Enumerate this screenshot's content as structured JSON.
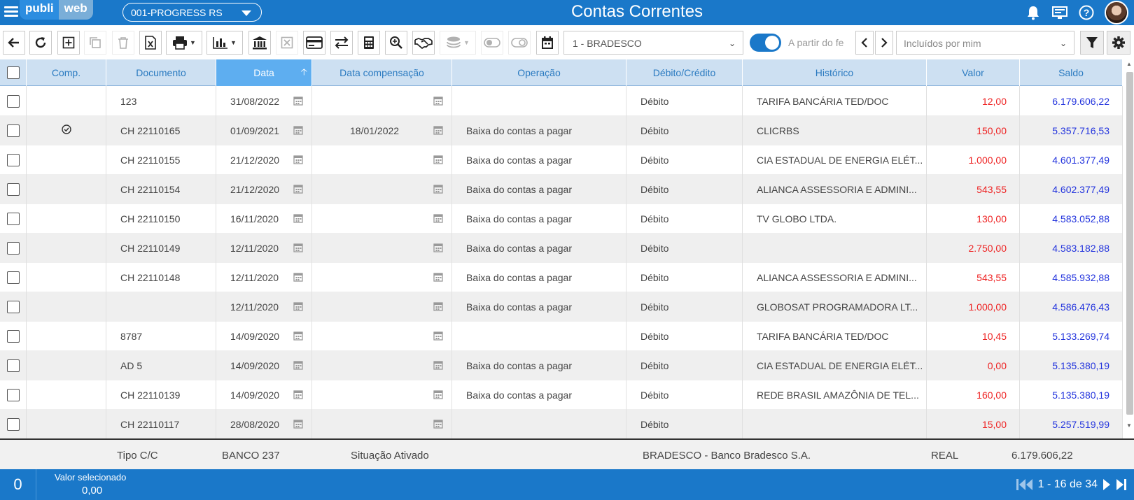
{
  "header": {
    "logo_left": "publi",
    "logo_right": "web",
    "company": "001-PROGRESS RS",
    "title": "Contas Correntes",
    "icons": [
      "bell-icon",
      "monitor-icon",
      "help-icon",
      "user-avatar"
    ]
  },
  "toolbar": {
    "buttons": [
      "back-icon",
      "refresh-icon",
      "add-icon",
      "copy-icon",
      "delete-icon",
      "excel-icon",
      "print-icon",
      "chart-icon",
      "bank-icon",
      "cancel-icon",
      "card-icon",
      "transfer-icon",
      "calculator-icon",
      "search-zoom-icon",
      "handshake-icon",
      "coins-icon",
      "toggle-off-icon",
      "toggle-link-icon",
      "calendar-icon"
    ],
    "bank": "1 - BRADESCO",
    "toggle_label": "A partir do fe",
    "included_filter": "Incluídos por mim"
  },
  "table": {
    "columns": [
      "Comp.",
      "Documento",
      "Data",
      "Data compensação",
      "Operação",
      "Débito/Crédito",
      "Histórico",
      "Valor",
      "Saldo"
    ],
    "sorted_column": "Data",
    "rows": [
      {
        "comp": false,
        "documento": "123",
        "data": "31/08/2022",
        "compensacao": "",
        "operacao": "",
        "dc": "Débito",
        "historico": "TARIFA BANCÁRIA TED/DOC",
        "valor": "12,00",
        "saldo": "6.179.606,22"
      },
      {
        "comp": true,
        "documento": "CH 22110165",
        "data": "01/09/2021",
        "compensacao": "18/01/2022",
        "operacao": "Baixa do contas a pagar",
        "dc": "Débito",
        "historico": "CLICRBS",
        "valor": "150,00",
        "saldo": "5.357.716,53"
      },
      {
        "comp": false,
        "documento": "CH 22110155",
        "data": "21/12/2020",
        "compensacao": "",
        "operacao": "Baixa do contas a pagar",
        "dc": "Débito",
        "historico": "CIA ESTADUAL DE ENERGIA ELÉT...",
        "valor": "1.000,00",
        "saldo": "4.601.377,49"
      },
      {
        "comp": false,
        "documento": "CH 22110154",
        "data": "21/12/2020",
        "compensacao": "",
        "operacao": "Baixa do contas a pagar",
        "dc": "Débito",
        "historico": "ALIANCA ASSESSORIA E ADMINI...",
        "valor": "543,55",
        "saldo": "4.602.377,49"
      },
      {
        "comp": false,
        "documento": "CH 22110150",
        "data": "16/11/2020",
        "compensacao": "",
        "operacao": "Baixa do contas a pagar",
        "dc": "Débito",
        "historico": "TV GLOBO LTDA.",
        "valor": "130,00",
        "saldo": "4.583.052,88"
      },
      {
        "comp": false,
        "documento": "CH 22110149",
        "data": "12/11/2020",
        "compensacao": "",
        "operacao": "Baixa do contas a pagar",
        "dc": "Débito",
        "historico": "",
        "valor": "2.750,00",
        "saldo": "4.583.182,88"
      },
      {
        "comp": false,
        "documento": "CH 22110148",
        "data": "12/11/2020",
        "compensacao": "",
        "operacao": "Baixa do contas a pagar",
        "dc": "Débito",
        "historico": "ALIANCA ASSESSORIA E ADMINI...",
        "valor": "543,55",
        "saldo": "4.585.932,88"
      },
      {
        "comp": false,
        "documento": "",
        "data": "12/11/2020",
        "compensacao": "",
        "operacao": "Baixa do contas a pagar",
        "dc": "Débito",
        "historico": "GLOBOSAT PROGRAMADORA LT...",
        "valor": "1.000,00",
        "saldo": "4.586.476,43"
      },
      {
        "comp": false,
        "documento": "8787",
        "data": "14/09/2020",
        "compensacao": "",
        "operacao": "",
        "dc": "Débito",
        "historico": "TARIFA BANCÁRIA TED/DOC",
        "valor": "10,45",
        "saldo": "5.133.269,74"
      },
      {
        "comp": false,
        "documento": "AD 5",
        "data": "14/09/2020",
        "compensacao": "",
        "operacao": "Baixa do contas a pagar",
        "dc": "Débito",
        "historico": "CIA ESTADUAL DE ENERGIA ELÉT...",
        "valor": "0,00",
        "saldo": "5.135.380,19"
      },
      {
        "comp": false,
        "documento": "CH 22110139",
        "data": "14/09/2020",
        "compensacao": "",
        "operacao": "Baixa do contas a pagar",
        "dc": "Débito",
        "historico": "REDE BRASIL AMAZÔNIA DE TEL...",
        "valor": "160,00",
        "saldo": "5.135.380,19"
      },
      {
        "comp": false,
        "documento": "CH 22110117",
        "data": "28/08/2020",
        "compensacao": "",
        "operacao": "",
        "dc": "Débito",
        "historico": "",
        "valor": "15,00",
        "saldo": "5.257.519,99"
      }
    ]
  },
  "summary": {
    "tipo": "Tipo C/C",
    "banco": "BANCO 237",
    "situacao": "Situação Ativado",
    "banco_nome": "BRADESCO - Banco Bradesco S.A.",
    "moeda": "REAL",
    "saldo": "6.179.606,22"
  },
  "status": {
    "selected_count": "0",
    "selected_label": "Valor selecionado",
    "selected_value": "0,00",
    "pager_text": "1 - 16 de 34"
  },
  "colors": {
    "primary": "#1a78c9",
    "header_row": "#cde0f2",
    "sorted_header": "#5eaef0",
    "negative": "#e22222",
    "positive": "#2233dd"
  }
}
